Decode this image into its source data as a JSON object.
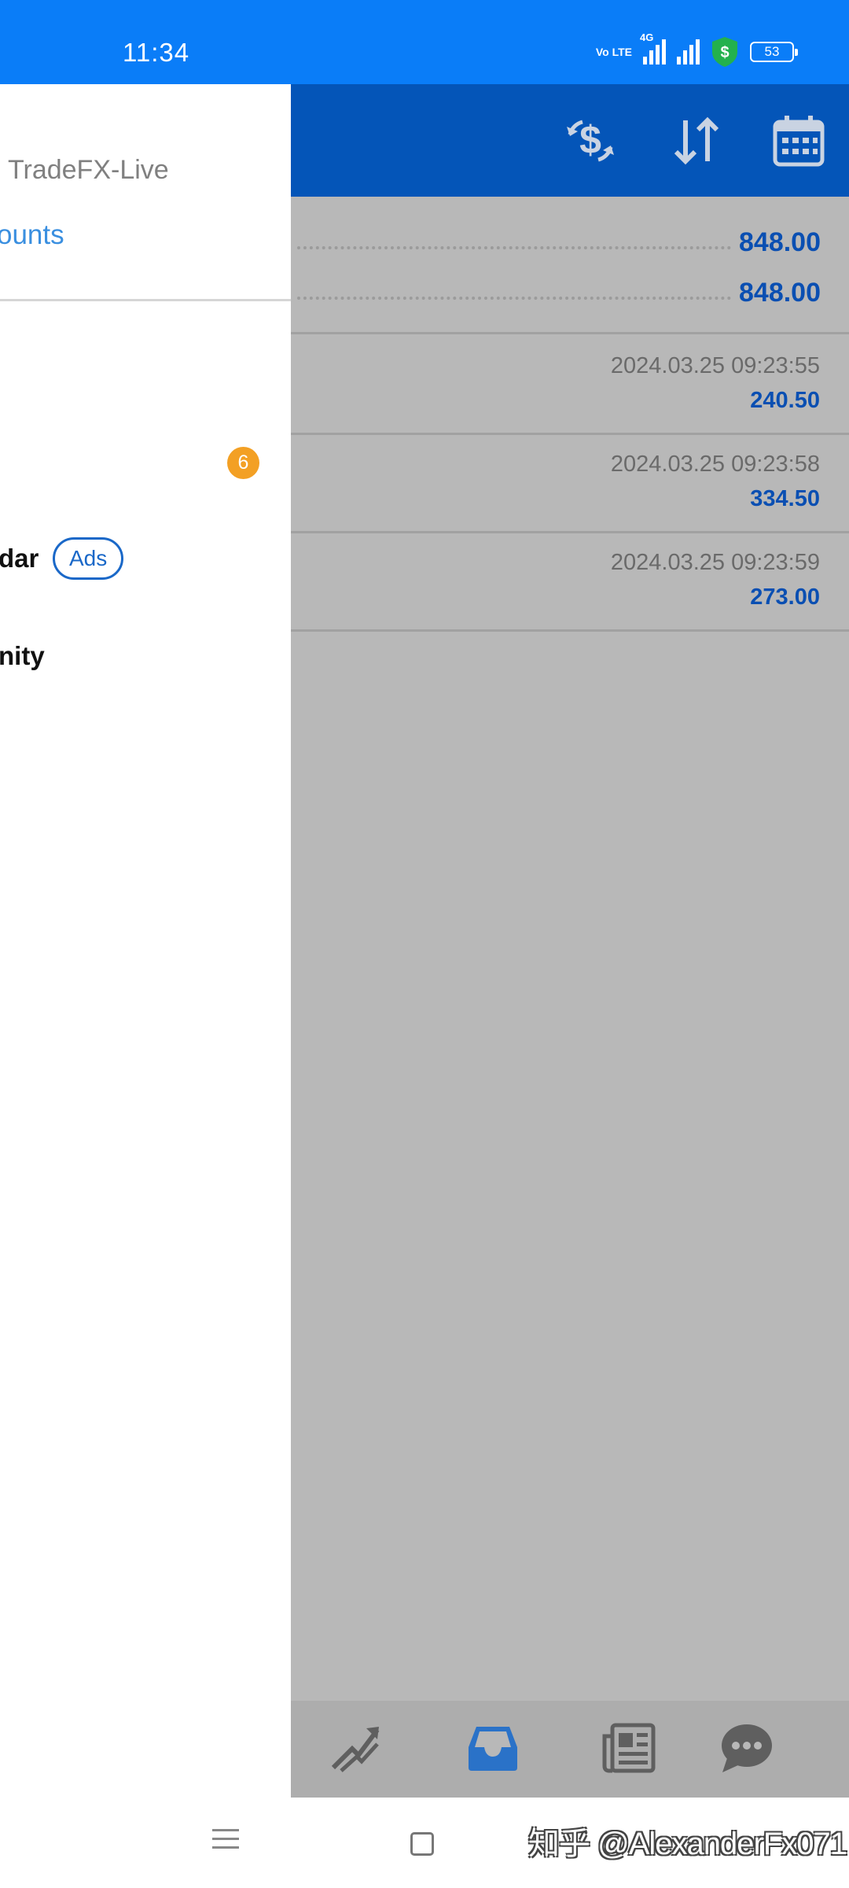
{
  "status_bar": {
    "time": "11:34",
    "volte_label": "Vo LTE",
    "network_type": "4G",
    "battery": "53",
    "colors": {
      "background": "#0a7df8",
      "shield": "#23b14d"
    }
  },
  "drawer": {
    "server_name": "TradeFX-Live",
    "accounts_link": "ounts",
    "menu_items": [
      {
        "label": "",
        "badge": "6"
      },
      {
        "label": "dar",
        "pill": "Ads"
      },
      {
        "label": "nity"
      }
    ]
  },
  "main": {
    "toolbar_icons": [
      "dollar-exchange-icon",
      "sort-arrows-icon",
      "calendar-icon"
    ],
    "summary": [
      "848.00",
      "848.00"
    ],
    "deals": [
      {
        "time": "2024.03.25 09:23:55",
        "amount": "240.50"
      },
      {
        "time": "2024.03.25 09:23:58",
        "amount": "334.50"
      },
      {
        "time": "2024.03.25 09:23:59",
        "amount": "273.00"
      }
    ],
    "bottom_nav": [
      "trade-chart-icon",
      "history-inbox-icon",
      "news-icon",
      "chat-icon"
    ],
    "colors": {
      "toolbar": "#0455b8",
      "value": "#0a4fb2",
      "active_nav": "#2a72c8"
    }
  },
  "system_nav": {
    "watermark": "知乎 @AlexanderFx071"
  }
}
